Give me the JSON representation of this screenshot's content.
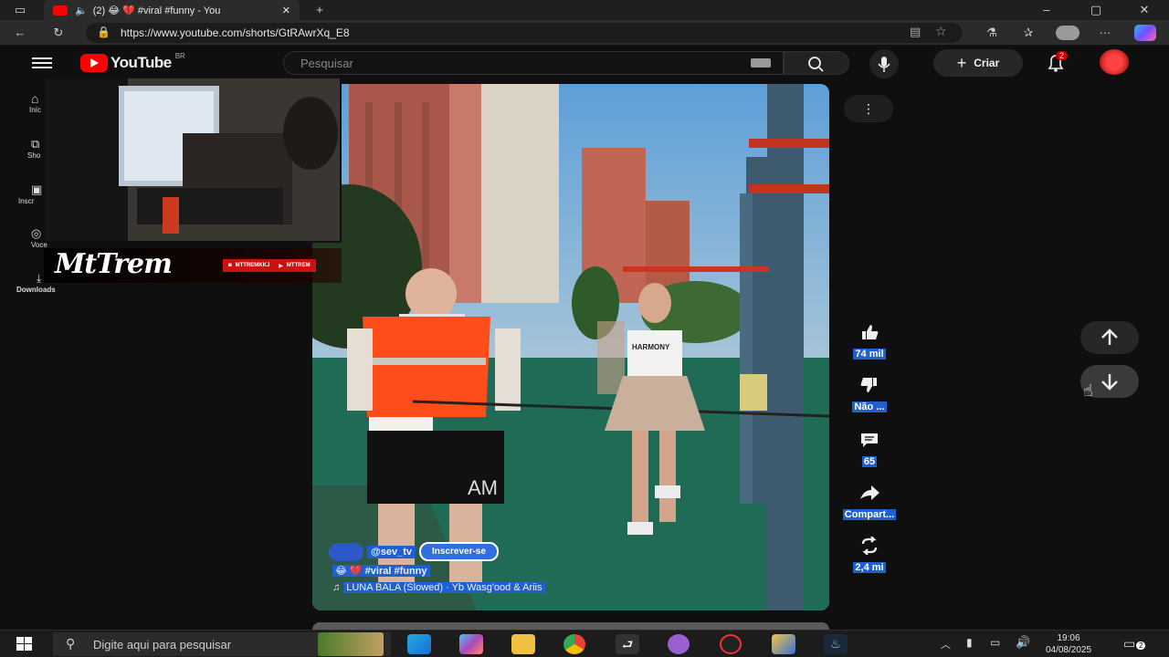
{
  "browser": {
    "tab_title": "(2) 😂 💔 #viral #funny - You",
    "url": "https://www.youtube.com/shorts/GtRAwrXq_E8",
    "window_controls": [
      "–",
      "▢",
      "✕"
    ]
  },
  "youtube": {
    "logo_text": "YouTube",
    "region": "BR",
    "search_placeholder": "Pesquisar",
    "create_label": "Criar",
    "notification_count": "2",
    "left_nav": [
      {
        "label": "Iníc",
        "icon": "home-icon"
      },
      {
        "label": "Sho",
        "icon": "shorts-icon"
      },
      {
        "label": "Inscr",
        "icon": "subscriptions-icon"
      },
      {
        "label": "Você",
        "icon": "you-icon"
      },
      {
        "label": "Downloads",
        "icon": "download-icon"
      }
    ]
  },
  "stream_overlay": {
    "streamer_name": "MtTrem",
    "social_1": "MTTREMKKJ",
    "social_2": "MTTREM"
  },
  "short": {
    "channel": "@sev_tv",
    "subscribe_label": "Inscrever-se",
    "caption": "😂 💔 #viral #funny",
    "music": "LUNA BALA (Slowed) · Yb Wasg'ood & Ariis",
    "shirt_text": "HARMONY"
  },
  "actions": {
    "like_count": "74 mil",
    "dislike_label": "Não ...",
    "comments_count": "65",
    "share_label": "Compart...",
    "remix_count": "2,4 mi"
  },
  "taskbar": {
    "search_placeholder": "Digite aqui para pesquisar",
    "time": "19:06",
    "date": "04/08/2025",
    "notif_badge": "2"
  },
  "colors": {
    "yt_red": "#ff0000",
    "highlight_blue": "#1f5fcf",
    "bg": "#0f0f0f"
  }
}
